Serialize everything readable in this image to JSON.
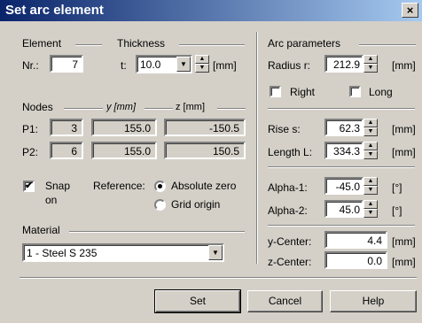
{
  "window": {
    "title": "Set arc element",
    "close_glyph": "×"
  },
  "element": {
    "group_label": "Element",
    "nr_label": "Nr.:",
    "nr_value": "7"
  },
  "thickness": {
    "group_label": "Thickness",
    "t_label": "t:",
    "value": "10.0",
    "unit": "[mm]"
  },
  "nodes": {
    "group_label": "Nodes",
    "y_header": "y [mm]",
    "z_header": "z [mm]",
    "rows": [
      {
        "label": "P1:",
        "node": "3",
        "y": "155.0",
        "z": "-150.5"
      },
      {
        "label": "P2:",
        "node": "6",
        "y": "155.0",
        "z": "150.5"
      }
    ]
  },
  "snap": {
    "label_line1": "Snap",
    "label_line2": "on",
    "checked": true
  },
  "reference": {
    "label": "Reference:",
    "options": [
      "Absolute zero",
      "Grid origin"
    ],
    "selected": "Absolute zero"
  },
  "material": {
    "group_label": "Material",
    "value": "1 - Steel S 235"
  },
  "arc": {
    "group_label": "Arc parameters",
    "radius_label": "Radius r:",
    "radius_value": "212.9",
    "radius_unit": "[mm]",
    "right_label": "Right",
    "long_label": "Long",
    "rise_label": "Rise s:",
    "rise_value": "62.3",
    "rise_unit": "[mm]",
    "length_label": "Length L:",
    "length_value": "334.3",
    "length_unit": "[mm]",
    "alpha1_label": "Alpha-1:",
    "alpha1_value": "-45.0",
    "alpha1_unit": "[°]",
    "alpha2_label": "Alpha-2:",
    "alpha2_value": "45.0",
    "alpha2_unit": "[°]",
    "ycenter_label": "y-Center:",
    "ycenter_value": "4.4",
    "ycenter_unit": "[mm]",
    "zcenter_label": "z-Center:",
    "zcenter_value": "0.0",
    "zcenter_unit": "[mm]"
  },
  "buttons": {
    "set": "Set",
    "cancel": "Cancel",
    "help": "Help"
  },
  "glyphs": {
    "check": "✔",
    "down": "▼",
    "up": "▲"
  }
}
